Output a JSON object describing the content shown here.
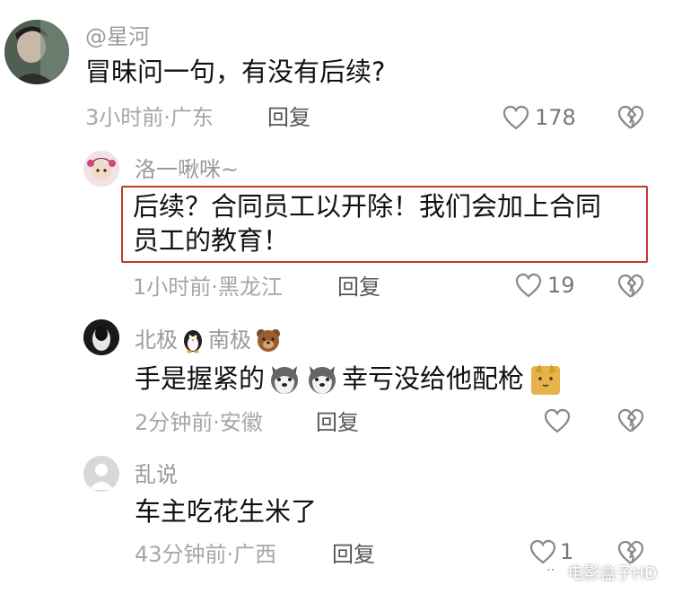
{
  "comments": [
    {
      "username": "@星河",
      "text": "冒昧问一句，有没有后续?",
      "meta": "3小时前·广东",
      "reply_label": "回复",
      "likes": "178"
    },
    {
      "username": "洛一啾咪~",
      "text_line1": "后续？合同员工以开除！我们会加上合同",
      "text_line2": "员工的教育！",
      "meta": "1小时前·黑龙江",
      "reply_label": "回复",
      "likes": "19"
    },
    {
      "username_part1": "北极",
      "username_part2": "南极",
      "text_part1": "手是握紧的",
      "text_part2": "幸亏没给他配枪",
      "meta": "2分钟前·安徽",
      "reply_label": "回复",
      "likes": ""
    },
    {
      "username": "乱说",
      "text": "车主吃花生米了",
      "meta": "43分钟前·广西",
      "reply_label": "回复",
      "likes": "1"
    }
  ],
  "watermark": {
    "text": "电影盒子HD"
  },
  "colors": {
    "highlight_border": "#c0392b",
    "username": "#9a9a9a",
    "meta": "#a6a6a6"
  }
}
